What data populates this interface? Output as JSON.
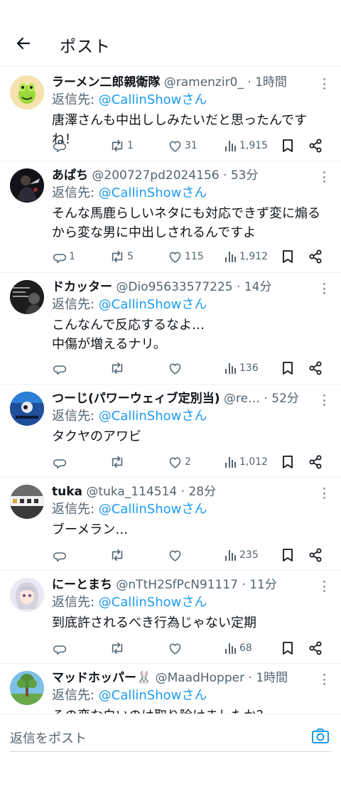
{
  "header": {
    "title": "ポスト"
  },
  "reply_prefix": "返信先: ",
  "tweets": [
    {
      "name": "ラーメン二郎親衛隊",
      "handle": "@ramenzir0_",
      "time": "1時間",
      "reply_to": "@CallinShowさん",
      "text": "唐澤さんも中出ししみたいだと思ったんですね！",
      "replies": "",
      "reposts": "1",
      "likes": "31",
      "views": "1,915",
      "avatar_icon": "frog-mascot-avatar"
    },
    {
      "name": "あぱち",
      "handle": "@200727pd2024156",
      "time": "53分",
      "reply_to": "@CallinShowさん",
      "text": "そんな馬鹿らしいネタにも対応できず変に煽るから変な男に中出しされるんですよ",
      "replies": "1",
      "reposts": "5",
      "likes": "115",
      "views": "1,912",
      "avatar_icon": "dark-figure-avatar"
    },
    {
      "name": "ドカッター",
      "handle": "@Dio95633577225",
      "time": "14分",
      "reply_to": "@CallinShowさん",
      "text": "こんなんで反応するなよ…\n中傷が増えるナリ。",
      "replies": "",
      "reposts": "",
      "likes": "",
      "views": "136",
      "avatar_icon": "hacker-avatar"
    },
    {
      "name": "つーじ(パワーウェィブ定別当)",
      "handle": "@re…",
      "time": "52分",
      "reply_to": "@CallinShowさん",
      "text": "タクヤのアワビ",
      "replies": "",
      "reposts": "",
      "likes": "2",
      "views": "1,012",
      "avatar_icon": "album-cover-avatar"
    },
    {
      "name": "tuka",
      "handle": "@tuka_114514",
      "time": "28分",
      "reply_to": "@CallinShowさん",
      "text": "ブーメラン…",
      "replies": "",
      "reposts": "",
      "likes": "",
      "views": "235",
      "avatar_icon": "storefront-avatar"
    },
    {
      "name": "にーとまち",
      "handle": "@nTtH2SfPcN91117",
      "time": "11分",
      "reply_to": "@CallinShowさん",
      "text": "到底許されるべき行為じゃない定期",
      "replies": "",
      "reposts": "",
      "likes": "",
      "views": "68",
      "avatar_icon": "anime-girl-avatar"
    },
    {
      "name": "マッドホッパー🐰",
      "handle": "@MaadHopper",
      "time": "1時間",
      "reply_to": "@CallinShowさん",
      "text": "その変な白いのは取り除けましたか？",
      "replies": "",
      "reposts": "",
      "likes": "",
      "views": "",
      "avatar_icon": "tree-landscape-avatar"
    }
  ],
  "composer": {
    "placeholder": "返信をポスト",
    "camera_icon": "camera-icon"
  },
  "colors": {
    "accent": "#1d9bf0",
    "secondary_text": "#536471",
    "divider": "#eff3f4"
  }
}
